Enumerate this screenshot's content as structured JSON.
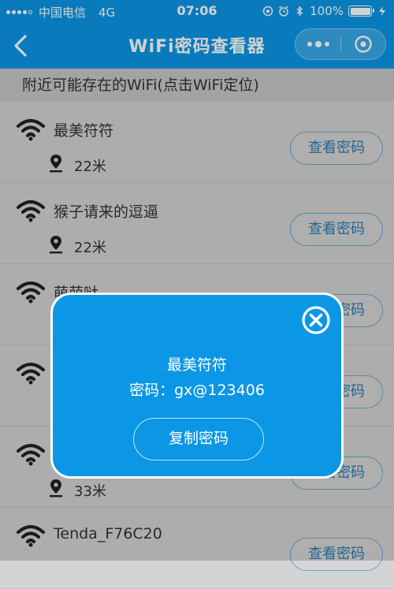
{
  "status_bar": {
    "carrier": "中国电信",
    "network": "4G",
    "time": "07:06",
    "battery": "100%",
    "battery_level": 1.0
  },
  "navbar": {
    "title": "WiFi密码查看器",
    "back_icon": "chevron-left-icon",
    "more_icon": "more-dots-icon",
    "close_icon": "capsule-close-icon"
  },
  "list": {
    "header": "附近可能存在的WiFi(点击WiFi定位)",
    "view_label": "查看密码",
    "items": [
      {
        "ssid": "最美符符",
        "distance": "22米"
      },
      {
        "ssid": "猴子请来的逗逼",
        "distance": "22米"
      },
      {
        "ssid": "萌萌哒",
        "distance": ""
      },
      {
        "ssid": "",
        "distance": ""
      },
      {
        "ssid": "",
        "distance": "33米"
      },
      {
        "ssid": "Tenda_F76C20",
        "distance": ""
      }
    ]
  },
  "modal": {
    "ssid": "最美符符",
    "password_text": "密码：gx@123406",
    "copy_label": "复制密码"
  },
  "colors": {
    "primary": "#0b96e6",
    "list_bg": "#d4d4d4",
    "button_text": "#2a7db3"
  }
}
